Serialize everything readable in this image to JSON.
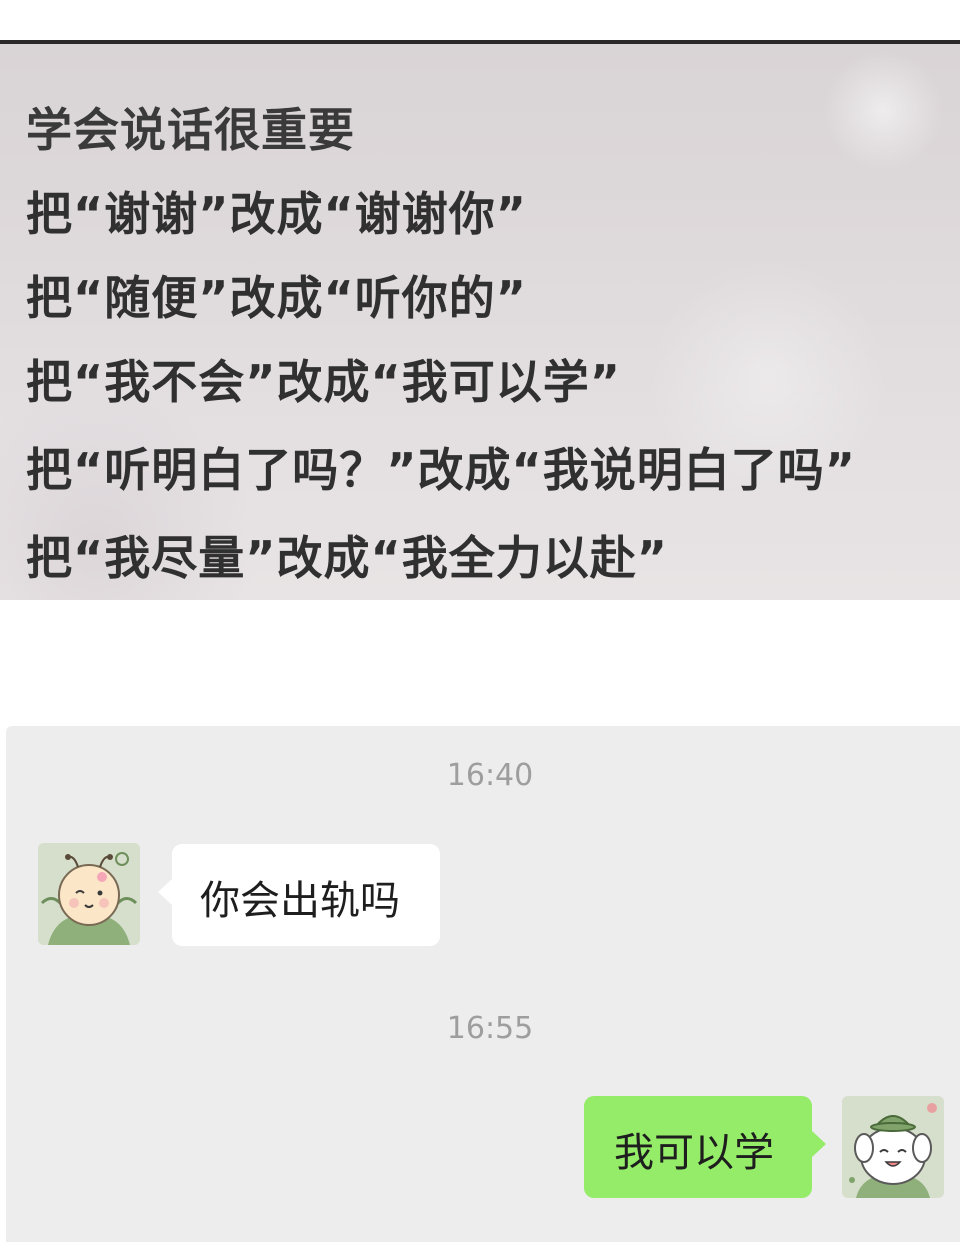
{
  "meme": {
    "title": "学会说话很重要",
    "lines": [
      "把“谢谢”改成“谢谢你”",
      "把“随便”改成“听你的”",
      "把“我不会”改成“我可以学”",
      "把“听明白了吗？”改成“我说明白了吗”",
      "把“我尽量”改成“我全力以赴”"
    ]
  },
  "chat": {
    "messages": [
      {
        "time": "16:40",
        "side": "left",
        "text": "你会出轨吗",
        "avatar": "green-cartoon-creature-avatar"
      },
      {
        "time": "16:55",
        "side": "right",
        "text": "我可以学",
        "avatar": "white-puppy-green-hat-avatar"
      }
    ]
  },
  "colors": {
    "outgoing_bubble": "#95ec69",
    "incoming_bubble": "#ffffff",
    "chat_background": "#ededed",
    "timestamp_text": "#9e9e9e"
  }
}
